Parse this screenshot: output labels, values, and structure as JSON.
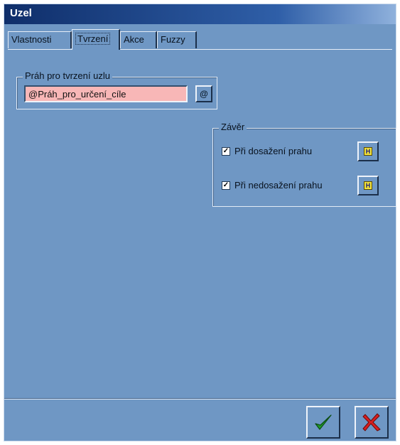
{
  "window": {
    "title": "Uzel"
  },
  "tabs": [
    {
      "label": "Vlastnosti",
      "active": false
    },
    {
      "label": "Tvrzení",
      "active": true
    },
    {
      "label": "Akce",
      "active": false
    },
    {
      "label": "Fuzzy",
      "active": false
    }
  ],
  "threshold_group": {
    "legend": "Práh pro tvrzení uzlu",
    "value": "@Práh_pro_určení_cíle",
    "field_color": "#f8b7b7"
  },
  "conclusion_group": {
    "legend": "Závěr",
    "items": [
      {
        "label": "Při dosažení prahu",
        "checked": true
      },
      {
        "label": "Při nedosažení prahu",
        "checked": true
      }
    ]
  },
  "footer": {
    "ok_color": "#1f9a2a",
    "cancel_color": "#d81f1f"
  },
  "colors": {
    "dialog_bg": "#6f97c4",
    "title_bar": "#0f2e6a"
  }
}
